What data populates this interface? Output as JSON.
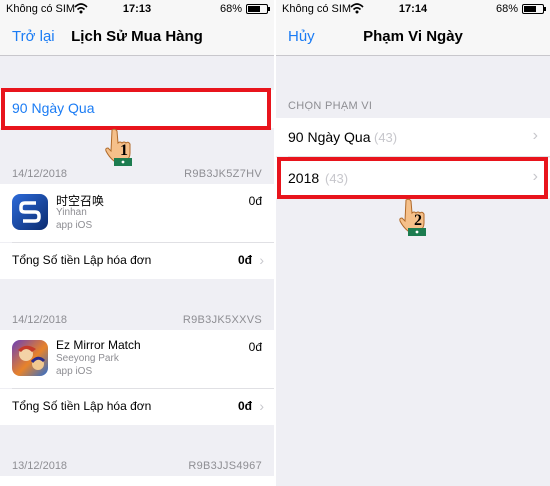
{
  "left": {
    "status": {
      "carrier": "Không có SIM",
      "time": "17:13",
      "battery": "68%"
    },
    "nav": {
      "back": "Trở lại",
      "title": "Lịch Sử Mua Hàng"
    },
    "range_label": "90 Ngày Qua",
    "step": "1",
    "groups": [
      {
        "date": "14/12/2018",
        "code": "R9B3JK5Z7HV",
        "app": {
          "name": "时空召唤",
          "developer": "Yinhan",
          "type": "app iOS",
          "price": "0đ"
        },
        "total_label": "Tổng Số tiền Lập hóa đơn",
        "total_value": "0đ"
      },
      {
        "date": "14/12/2018",
        "code": "R9B3JK5XXVS",
        "app": {
          "name": "Ez Mirror Match",
          "developer": "Seeyong Park",
          "type": "app iOS",
          "price": "0đ"
        },
        "total_label": "Tổng Số tiền Lập hóa đơn",
        "total_value": "0đ"
      },
      {
        "date": "13/12/2018",
        "code": "R9B3JJS4967"
      }
    ]
  },
  "right": {
    "status": {
      "carrier": "Không có SIM",
      "time": "17:14",
      "battery": "68%"
    },
    "nav": {
      "cancel": "Hủy",
      "title": "Phạm Vi Ngày"
    },
    "section_header": "CHỌN PHẠM VI",
    "options": [
      {
        "label": "90 Ngày Qua",
        "count": "(43)"
      },
      {
        "label": "2018",
        "count": "(43)"
      }
    ],
    "step": "2"
  },
  "colors": {
    "accent": "#1b7cf4",
    "highlight": "#e8141c",
    "background": "#efeff4"
  },
  "icons": [
    "wifi-icon",
    "battery-icon",
    "chevron-right-icon",
    "pointing-hand-icon"
  ]
}
